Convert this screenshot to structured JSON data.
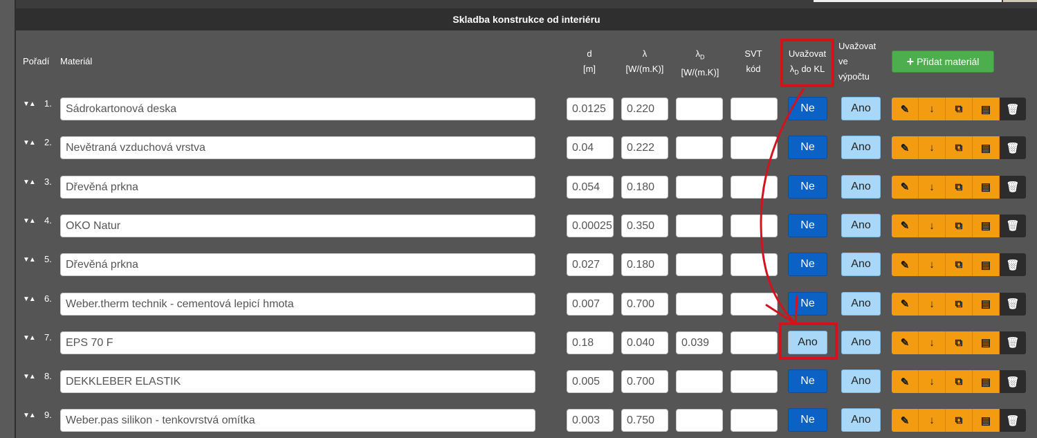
{
  "panel_title": "Skladba konstrukce od interiéru",
  "headers": {
    "order": "Pořadí",
    "material": "Materiál",
    "d_line1": "d",
    "d_line2": "[m]",
    "lambda_line1": "λ",
    "lambda_line2": "[W/(m.K)]",
    "lambdad_line1": "λD",
    "lambdad_line2": "[W/(m.K)]",
    "svt_line1": "SVT",
    "svt_line2": "kód",
    "kl_line1": "Uvažovat",
    "kl_line2": "λD do KL",
    "calc_line1": "Uvažovat",
    "calc_line2": "ve",
    "calc_line3": "výpočtu"
  },
  "add_button": {
    "icon": "plus-icon",
    "label": "Přidat materiál"
  },
  "action_icons": [
    "edit-icon",
    "arrow-down-icon",
    "copy-icon",
    "table-icon",
    "trash-icon"
  ],
  "rows": [
    {
      "order": "1.",
      "material": "Sádrokartonová deska",
      "d": "0.0125",
      "lambda": "0.220",
      "lambda_d": "",
      "svt": "",
      "kl": "Ne",
      "calc": "Ano"
    },
    {
      "order": "2.",
      "material": "Nevětraná vzduchová vrstva",
      "d": "0.04",
      "lambda": "0.222",
      "lambda_d": "",
      "svt": "",
      "kl": "Ne",
      "calc": "Ano"
    },
    {
      "order": "3.",
      "material": "Dřevěná prkna",
      "d": "0.054",
      "lambda": "0.180",
      "lambda_d": "",
      "svt": "",
      "kl": "Ne",
      "calc": "Ano"
    },
    {
      "order": "4.",
      "material": "OKO Natur",
      "d": "0.00025",
      "lambda": "0.350",
      "lambda_d": "",
      "svt": "",
      "kl": "Ne",
      "calc": "Ano"
    },
    {
      "order": "5.",
      "material": "Dřevěná prkna",
      "d": "0.027",
      "lambda": "0.180",
      "lambda_d": "",
      "svt": "",
      "kl": "Ne",
      "calc": "Ano"
    },
    {
      "order": "6.",
      "material": "Weber.therm technik - cementová lepicí hmota",
      "d": "0.007",
      "lambda": "0.700",
      "lambda_d": "",
      "svt": "",
      "kl": "Ne",
      "calc": "Ano"
    },
    {
      "order": "7.",
      "material": "EPS 70 F",
      "d": "0.18",
      "lambda": "0.040",
      "lambda_d": "0.039",
      "svt": "",
      "kl": "Ano",
      "calc": "Ano"
    },
    {
      "order": "8.",
      "material": "DEKKLEBER ELASTIK",
      "d": "0.005",
      "lambda": "0.700",
      "lambda_d": "",
      "svt": "",
      "kl": "Ne",
      "calc": "Ano"
    },
    {
      "order": "9.",
      "material": "Weber.pas silikon - tenkovrstvá omítka",
      "d": "0.003",
      "lambda": "0.750",
      "lambda_d": "",
      "svt": "",
      "kl": "Ne",
      "calc": "Ano"
    }
  ],
  "colors": {
    "annotation": "#d3121c",
    "ne_button": "#0b62c4",
    "ano_button": "#a8d7f7",
    "action_button": "#f39c12",
    "add_button": "#4cae4c"
  }
}
